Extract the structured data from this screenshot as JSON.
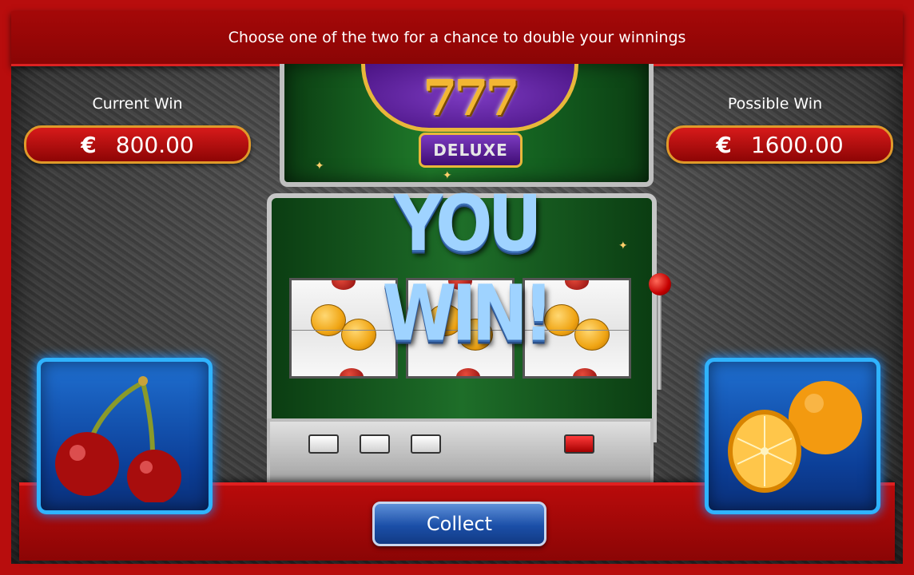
{
  "banner": {
    "text": "Choose one of the two for a chance to double your winnings"
  },
  "current_win": {
    "label": "Current Win",
    "currency": "€",
    "amount": "800.00"
  },
  "possible_win": {
    "label": "Possible Win",
    "currency": "€",
    "amount": "1600.00"
  },
  "machine": {
    "logo_text": "777",
    "logo_sub": "DELUXE",
    "win_text": "YOU WIN!",
    "reel_symbols": [
      "cherry",
      "orange",
      "cherry"
    ]
  },
  "choices": [
    {
      "name": "cherry",
      "icon": "cherry-icon"
    },
    {
      "name": "orange",
      "icon": "orange-icon"
    }
  ],
  "collect": {
    "label": "Collect"
  },
  "colors": {
    "frame_red": "#b80d0d",
    "choice_blue": "#1f6fd0",
    "accent_gold": "#e09a2a"
  }
}
